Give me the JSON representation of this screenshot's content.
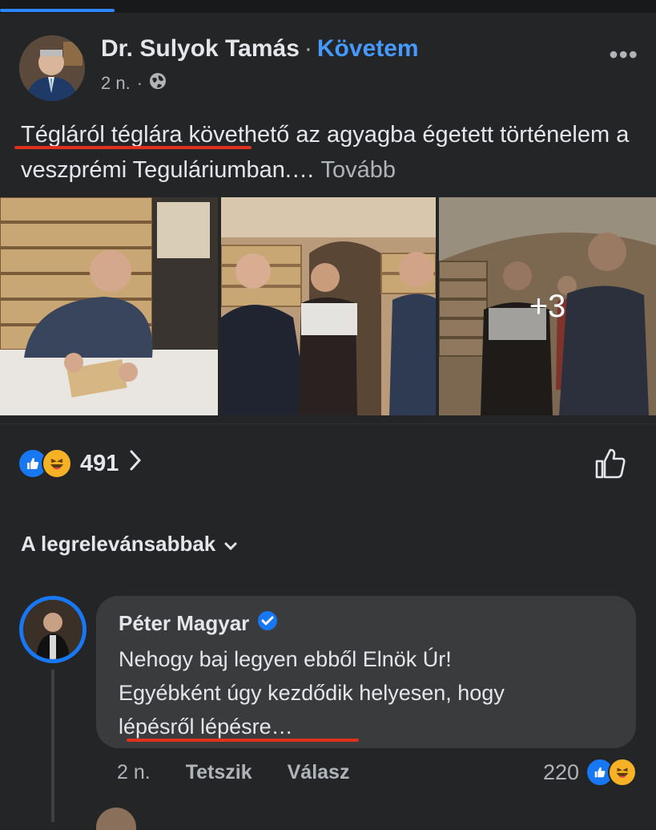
{
  "post": {
    "author": "Dr. Sulyok Tamás",
    "separator": "·",
    "follow_label": "Követem",
    "time": "2 n.",
    "time_separator": "·",
    "privacy_icon": "globe-icon",
    "more_label": "•••",
    "text": "Tégláról téglára követhető az agyagba égetett történelem a veszprémi Teguláriumban.…",
    "see_more": "Tovább",
    "photos_more": "+3"
  },
  "reactions": {
    "types": [
      "like",
      "haha"
    ],
    "count": "491",
    "like_icon": "thumbs-up-icon"
  },
  "sort": {
    "label": "A legrelevánsabbak"
  },
  "comment": {
    "author": "Péter Magyar",
    "verified": true,
    "line1": "Nehogy baj legyen ebből Elnök Úr!",
    "line2": "Egyébként úgy kezdődik helyesen, hogy",
    "line3": "lépésről lépésre…",
    "time": "2 n.",
    "like_label": "Tetszik",
    "reply_label": "Válasz",
    "reaction_count": "220"
  },
  "colors": {
    "background": "#242526",
    "accent": "#4599ff",
    "like_blue": "#1877f2",
    "haha_yellow": "#f7b125",
    "annotation_red": "#e0311f"
  }
}
